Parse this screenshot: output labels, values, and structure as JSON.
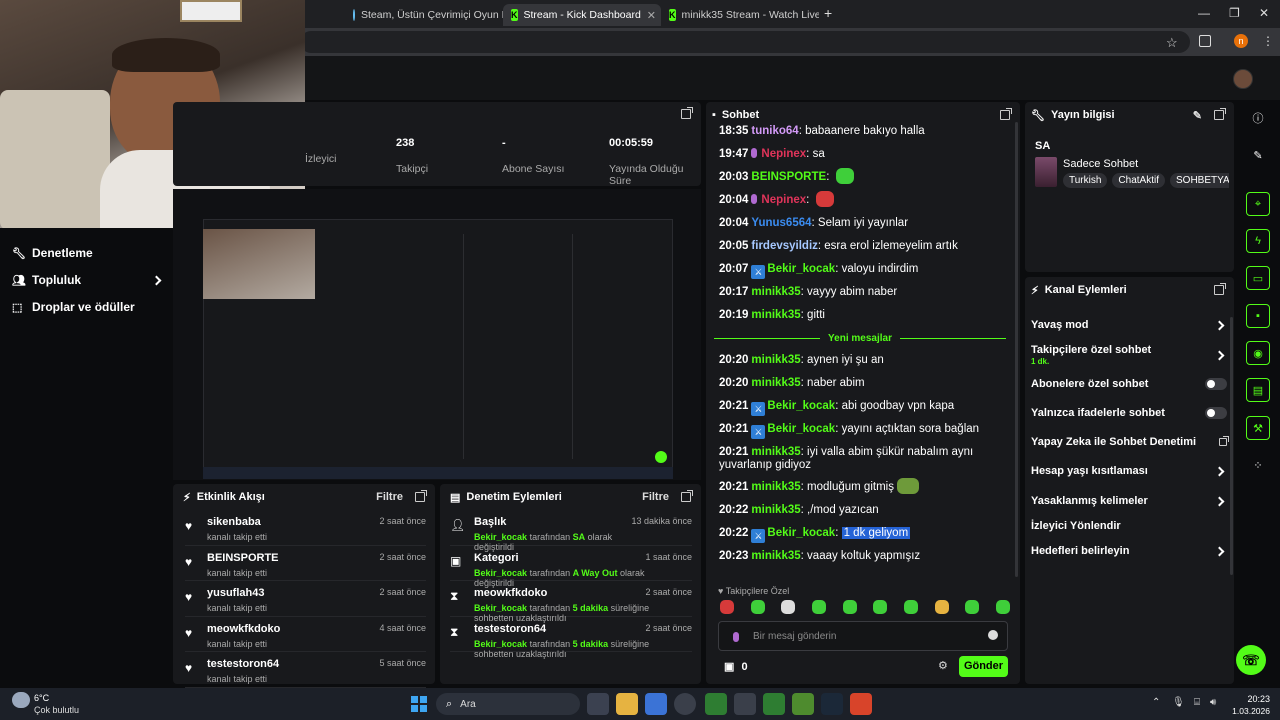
{
  "browser": {
    "tabs": [
      {
        "label": "Steam, Üstün Çevrimiçi Oyun P"
      },
      {
        "label": "Stream - Kick Dashboard"
      },
      {
        "label": "minikk35 Stream - Watch Live o"
      }
    ],
    "new_tab": "+",
    "profile_initial": "n"
  },
  "stats": [
    {
      "value": "",
      "label": "İzleyici"
    },
    {
      "value": "238",
      "label": "Takipçi"
    },
    {
      "value": "-",
      "label": "Abone Sayısı"
    },
    {
      "value": "00:05:59",
      "label": "Yayında Olduğu Süre"
    }
  ],
  "sidebar": {
    "items": [
      {
        "label": "Denetleme"
      },
      {
        "label": "Topluluk"
      },
      {
        "label": "Droplar ve ödüller"
      }
    ]
  },
  "activity": {
    "title": "Etkinlik Akışı",
    "filter": "Filtre",
    "items": [
      {
        "name": "sikenbaba",
        "desc": "kanalı takip etti",
        "time": "2 saat önce"
      },
      {
        "name": "BEINSPORTE",
        "desc": "kanalı takip etti",
        "time": "2 saat önce"
      },
      {
        "name": "yusuflah43",
        "desc": "kanalı takip etti",
        "time": "2 saat önce"
      },
      {
        "name": "meowkfkdoko",
        "desc": "kanalı takip etti",
        "time": "4 saat önce"
      },
      {
        "name": "testestoron64",
        "desc": "kanalı takip etti",
        "time": "5 saat önce"
      }
    ]
  },
  "modactions": {
    "title": "Denetim Eylemleri",
    "filter": "Filtre",
    "items": [
      {
        "title": "Başlık",
        "by": "Bekir_kocak",
        "mid": "tarafından",
        "val": "SA",
        "end": "olarak değiştirildi",
        "time": "13 dakika önce"
      },
      {
        "title": "Kategori",
        "by": "Bekir_kocak",
        "mid": "tarafından",
        "val": "A Way Out",
        "end": "olarak değiştirildi",
        "time": "1 saat önce"
      },
      {
        "title": "meowkfkdoko",
        "by": "Bekir_kocak",
        "mid": "tarafından",
        "val": "5 dakika",
        "end": "süreliğine sohbetten uzaklaştırıldı",
        "time": "2 saat önce"
      },
      {
        "title": "testestoron64",
        "by": "Bekir_kocak",
        "mid": "tarafından",
        "val": "5 dakika",
        "end": "süreliğine sohbetten uzaklaştırıldı",
        "time": "2 saat önce"
      }
    ]
  },
  "chat": {
    "title": "Sohbet",
    "new_messages": "Yeni mesajlar",
    "messages": [
      {
        "time": "18:35",
        "user": "tuniko64",
        "color": "#d39af7",
        "text": "babaanere bakıyo halla"
      },
      {
        "time": "19:47",
        "user": "Nepinex",
        "color": "#e0345a",
        "text": "sa"
      },
      {
        "time": "20:03",
        "user": "BEINSPORTE",
        "color": "#53fc18",
        "text": ""
      },
      {
        "time": "20:04",
        "user": "Nepinex",
        "color": "#e0345a",
        "text": ""
      },
      {
        "time": "20:04",
        "user": "Yunus6564",
        "color": "#3b8cf0",
        "text": "Selam iyi yayınlar"
      },
      {
        "time": "20:05",
        "user": "firdevsyildiz",
        "color": "#a6c8ff",
        "text": "esra erol izlemeyelim artık"
      },
      {
        "time": "20:07",
        "user": "Bekir_kocak",
        "color": "#53fc18",
        "text": "valoyu indirdim"
      },
      {
        "time": "20:17",
        "user": "minikk35",
        "color": "#53fc18",
        "text": "vayyy abim naber"
      },
      {
        "time": "20:19",
        "user": "minikk35",
        "color": "#53fc18",
        "text": "gitti"
      },
      {
        "time": "20:20",
        "user": "minikk35",
        "color": "#53fc18",
        "text": "aynen iyi şu an"
      },
      {
        "time": "20:20",
        "user": "minikk35",
        "color": "#53fc18",
        "text": "naber abim"
      },
      {
        "time": "20:21",
        "user": "Bekir_kocak",
        "color": "#53fc18",
        "text": "abi goodbay vpn kapa"
      },
      {
        "time": "20:21",
        "user": "Bekir_kocak",
        "color": "#53fc18",
        "text": "yayını açtıktan sora bağlan"
      },
      {
        "time": "20:21",
        "user": "minikk35",
        "color": "#53fc18",
        "text": "iyi valla abim şükür nabalım aynı"
      },
      {
        "time": "",
        "user": "",
        "color": "#53fc18",
        "text": "yuvarlanıp gidiyoz"
      },
      {
        "time": "20:21",
        "user": "minikk35",
        "color": "#53fc18",
        "text": "modluğum gitmiş"
      },
      {
        "time": "20:22",
        "user": "minikk35",
        "color": "#53fc18",
        "text": ",/mod yazıcan"
      },
      {
        "time": "20:22",
        "user": "Bekir_kocak",
        "color": "#53fc18",
        "text": "1 dk geliyom"
      },
      {
        "time": "20:23",
        "user": "minikk35",
        "color": "#53fc18",
        "text": "vaaay koltuk yapmışız"
      }
    ],
    "followers_only": "Takipçilere Özel",
    "input_placeholder": "Bir mesaj gönderin",
    "points": "0",
    "send": "Gönder"
  },
  "stream_info": {
    "title": "Yayın bilgisi",
    "stream_title": "SA",
    "category": "Sadece Sohbet",
    "tags": [
      "Turkish",
      "ChatAktif",
      "SOHBETYA"
    ]
  },
  "channel_actions": {
    "title": "Kanal Eylemleri",
    "items": [
      {
        "label": "Yavaş mod",
        "sub": ""
      },
      {
        "label": "Takipçilere özel sohbet",
        "sub": "1 dk."
      },
      {
        "label": "Abonelere özel sohbet",
        "sub": ""
      },
      {
        "label": "Yalnızca ifadelerle sohbet",
        "sub": ""
      },
      {
        "label": "Yapay Zeka ile Sohbet Denetimi",
        "sub": ""
      },
      {
        "label": "Hesap yaşı kısıtlaması",
        "sub": ""
      },
      {
        "label": "Yasaklanmış kelimeler",
        "sub": ""
      },
      {
        "label": "İzleyici Yönlendir",
        "sub": ""
      },
      {
        "label": "Hedefleri belirleyin",
        "sub": ""
      }
    ]
  },
  "taskbar": {
    "weather_temp": "6°C",
    "weather_desc": "Çok bulutlu",
    "search": "Ara",
    "time": "20:23",
    "date": "1.03.2026"
  }
}
